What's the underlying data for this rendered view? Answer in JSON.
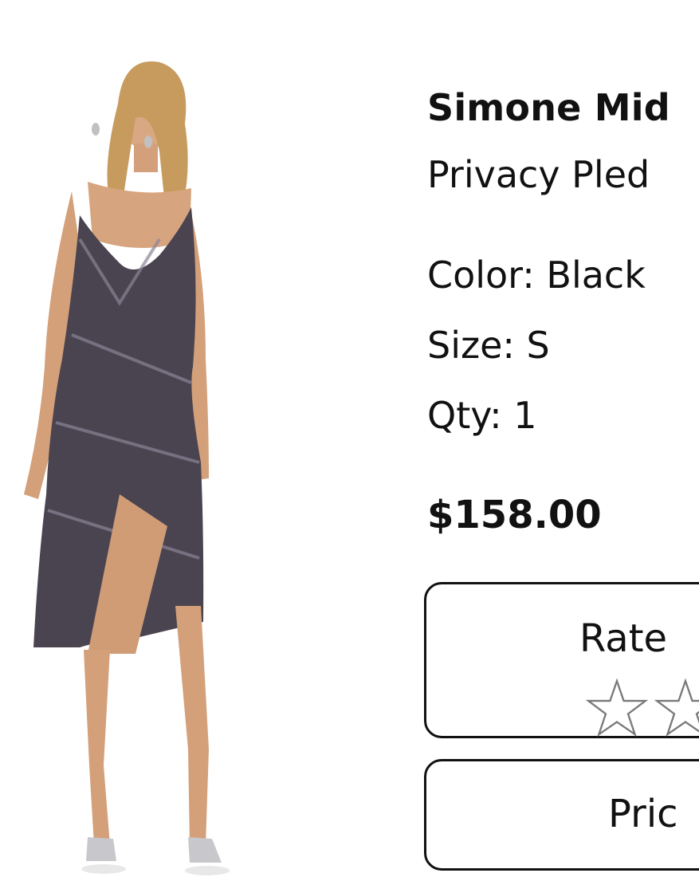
{
  "product": {
    "title": "Simone Mid",
    "brand": "Privacy Pled",
    "color": "Color: Black",
    "size": "Size: S",
    "qty": "Qty: 1",
    "price": "$158.00",
    "image_icon": "product-photo"
  },
  "rating": {
    "label": "Rate",
    "stars_visible": 2,
    "rating_value": 0,
    "star_icon": "star-outline-icon"
  },
  "price_button": {
    "label": "Pric"
  }
}
